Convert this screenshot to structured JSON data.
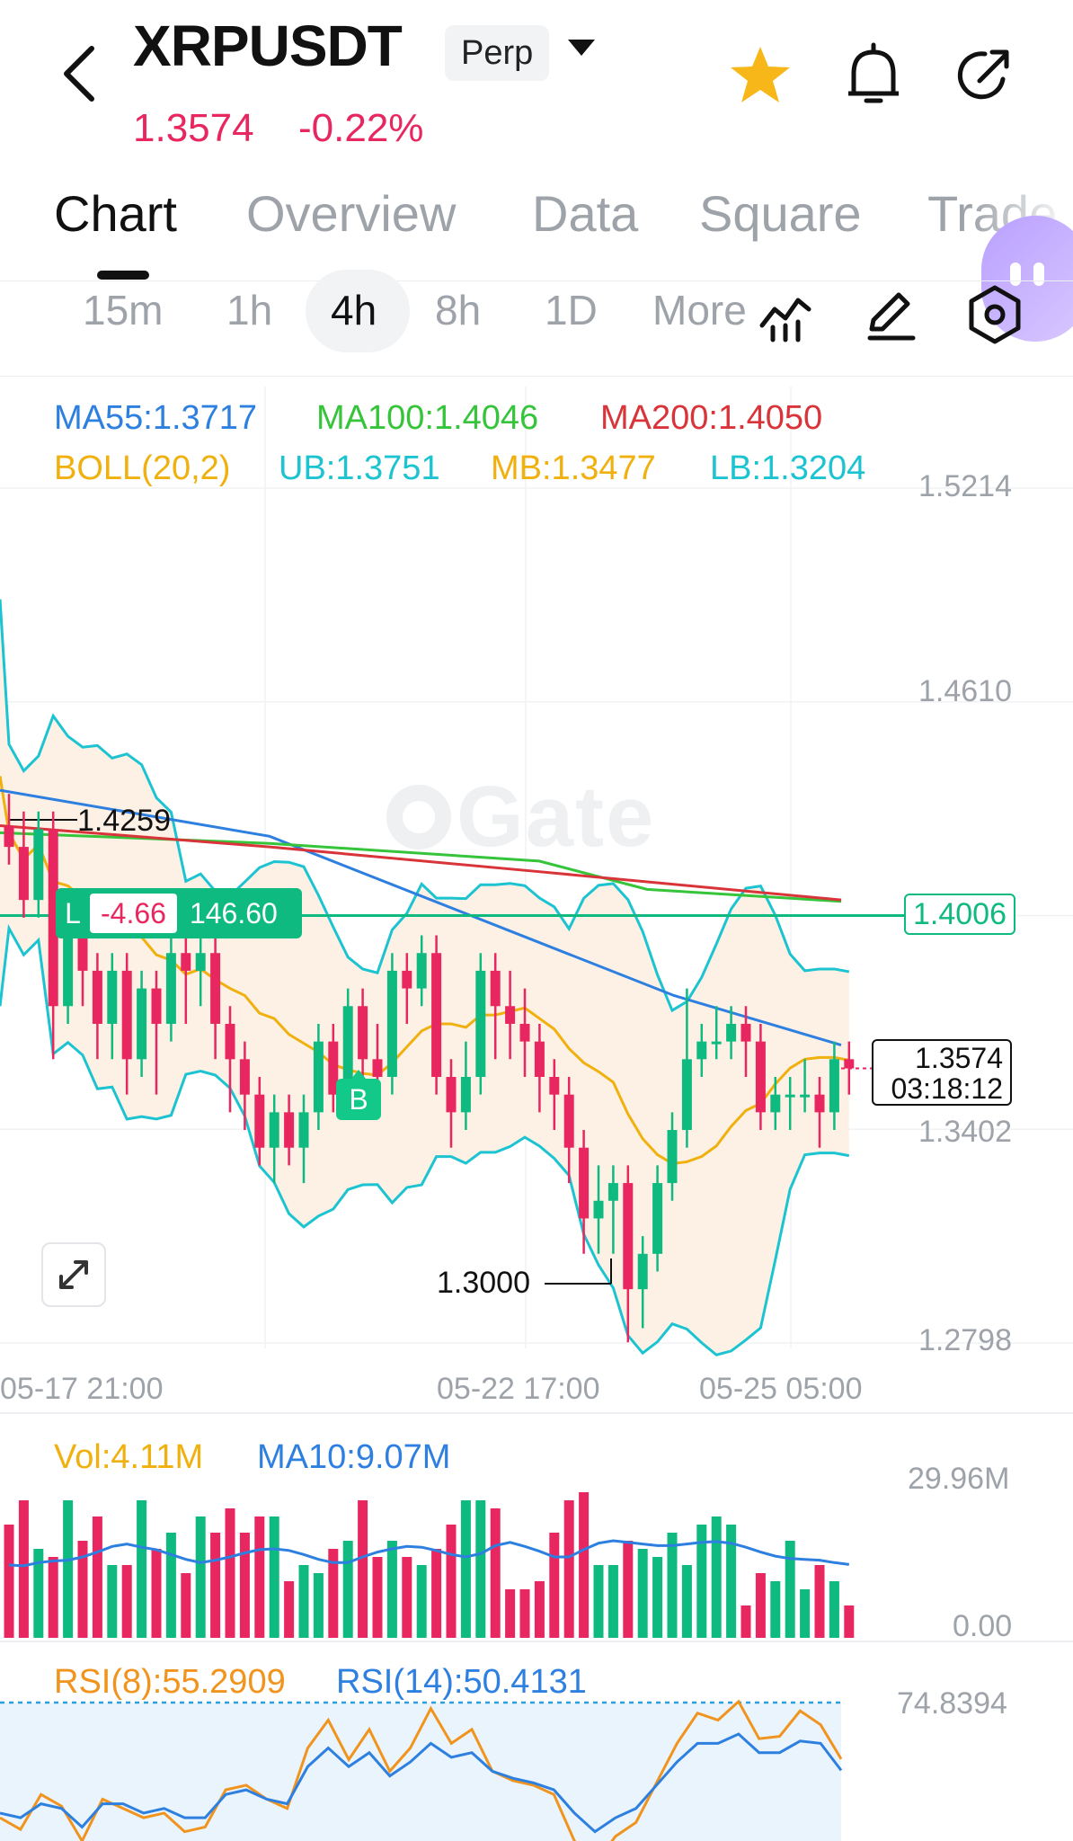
{
  "header": {
    "back_icon": "chevron-left-icon",
    "symbol": "XRPUSDT",
    "contract_type": "Perp",
    "price": "1.3574",
    "change": "-0.22%",
    "icons": [
      "star-icon",
      "bell-icon",
      "share-icon"
    ],
    "colors": {
      "down": "#e8265f",
      "up": "#0fba81",
      "star": "#f7b718"
    }
  },
  "tabs": [
    {
      "label": "Chart",
      "active": true
    },
    {
      "label": "Overview"
    },
    {
      "label": "Data"
    },
    {
      "label": "Square"
    },
    {
      "label": "Trade"
    }
  ],
  "timeframes": [
    {
      "label": "15m"
    },
    {
      "label": "1h"
    },
    {
      "label": "4h",
      "active": true
    },
    {
      "label": "8h"
    },
    {
      "label": "1D"
    },
    {
      "label": "More"
    }
  ],
  "toolbar_icons": [
    "indicator-icon",
    "draw-pen-icon",
    "settings-hex-icon"
  ],
  "indicators": {
    "ma55": "MA55:1.3717",
    "ma100": "MA100:1.4046",
    "ma200": "MA200:1.4050",
    "boll": "BOLL(20,2)",
    "ub": "UB:1.3751",
    "mb": "MB:1.3477",
    "lb": "LB:1.3204"
  },
  "price_axis": [
    "1.5214",
    "1.4610",
    "1.3402",
    "1.2798"
  ],
  "time_axis": [
    "05-17 21:00",
    "05-22 17:00",
    "05-25 05:00"
  ],
  "watermark": "Gate",
  "high_label": "1.4259",
  "low_label": "1.3000",
  "position": {
    "side": "L",
    "pnl": "-4.66",
    "entry": "146.60",
    "line_price": "1.4006"
  },
  "current_tag": {
    "price": "1.3574",
    "countdown": "03:18:12"
  },
  "buy_marker": "B",
  "volume": {
    "vol": "Vol:4.11M",
    "ma10": "MA10:9.07M",
    "max": "29.96M",
    "min": "0.00"
  },
  "rsi": {
    "rsi8": "RSI(8):55.2909",
    "rsi14": "RSI(14):50.4131",
    "top": "74.8394"
  },
  "chart_data": {
    "type": "candlestick",
    "y_range": [
      1.2798,
      1.5214
    ],
    "candles": [
      [
        1.4259,
        1.42,
        1.435,
        1.415
      ],
      [
        1.42,
        1.405,
        1.43,
        1.4
      ],
      [
        1.405,
        1.425,
        1.43,
        1.4
      ],
      [
        1.425,
        1.375,
        1.43,
        1.36
      ],
      [
        1.375,
        1.4,
        1.405,
        1.37
      ],
      [
        1.4,
        1.385,
        1.4,
        1.375
      ],
      [
        1.385,
        1.37,
        1.39,
        1.36
      ],
      [
        1.37,
        1.385,
        1.39,
        1.36
      ],
      [
        1.385,
        1.36,
        1.39,
        1.35
      ],
      [
        1.36,
        1.38,
        1.385,
        1.355
      ],
      [
        1.38,
        1.37,
        1.385,
        1.35
      ],
      [
        1.37,
        1.39,
        1.395,
        1.365
      ],
      [
        1.39,
        1.385,
        1.395,
        1.37
      ],
      [
        1.385,
        1.39,
        1.395,
        1.375
      ],
      [
        1.39,
        1.37,
        1.395,
        1.36
      ],
      [
        1.37,
        1.36,
        1.375,
        1.345
      ],
      [
        1.36,
        1.35,
        1.365,
        1.34
      ],
      [
        1.35,
        1.335,
        1.355,
        1.33
      ],
      [
        1.335,
        1.345,
        1.35,
        1.325
      ],
      [
        1.345,
        1.335,
        1.35,
        1.33
      ],
      [
        1.335,
        1.345,
        1.35,
        1.325
      ],
      [
        1.345,
        1.365,
        1.37,
        1.34
      ],
      [
        1.365,
        1.35,
        1.37,
        1.345
      ],
      [
        1.35,
        1.375,
        1.38,
        1.345
      ],
      [
        1.375,
        1.36,
        1.38,
        1.35
      ],
      [
        1.36,
        1.355,
        1.37,
        1.345
      ],
      [
        1.355,
        1.385,
        1.39,
        1.35
      ],
      [
        1.385,
        1.38,
        1.39,
        1.37
      ],
      [
        1.38,
        1.39,
        1.395,
        1.375
      ],
      [
        1.39,
        1.355,
        1.395,
        1.35
      ],
      [
        1.355,
        1.345,
        1.36,
        1.335
      ],
      [
        1.345,
        1.355,
        1.365,
        1.34
      ],
      [
        1.355,
        1.385,
        1.39,
        1.35
      ],
      [
        1.385,
        1.375,
        1.39,
        1.36
      ],
      [
        1.375,
        1.37,
        1.385,
        1.36
      ],
      [
        1.37,
        1.365,
        1.38,
        1.355
      ],
      [
        1.365,
        1.355,
        1.37,
        1.345
      ],
      [
        1.355,
        1.35,
        1.36,
        1.34
      ],
      [
        1.35,
        1.335,
        1.355,
        1.325
      ],
      [
        1.335,
        1.315,
        1.34,
        1.305
      ],
      [
        1.315,
        1.32,
        1.33,
        1.305
      ],
      [
        1.32,
        1.325,
        1.33,
        1.305
      ],
      [
        1.325,
        1.295,
        1.33,
        1.28
      ],
      [
        1.295,
        1.305,
        1.31,
        1.284
      ],
      [
        1.305,
        1.325,
        1.33,
        1.3
      ],
      [
        1.325,
        1.34,
        1.345,
        1.32
      ],
      [
        1.34,
        1.36,
        1.38,
        1.335
      ],
      [
        1.36,
        1.365,
        1.37,
        1.355
      ],
      [
        1.365,
        1.365,
        1.375,
        1.36
      ],
      [
        1.365,
        1.37,
        1.375,
        1.36
      ],
      [
        1.37,
        1.365,
        1.375,
        1.355
      ],
      [
        1.365,
        1.345,
        1.37,
        1.34
      ],
      [
        1.345,
        1.35,
        1.355,
        1.34
      ],
      [
        1.35,
        1.35,
        1.355,
        1.34
      ],
      [
        1.35,
        1.35,
        1.36,
        1.345
      ],
      [
        1.35,
        1.345,
        1.355,
        1.335
      ],
      [
        1.345,
        1.36,
        1.365,
        1.34
      ],
      [
        1.36,
        1.3574,
        1.365,
        1.35
      ]
    ],
    "volume": [
      14,
      17,
      11,
      10,
      17,
      12,
      15,
      9,
      9,
      17,
      11,
      13,
      8,
      15,
      13,
      16,
      13,
      15,
      15,
      7,
      9,
      8,
      11,
      12,
      17,
      10,
      12,
      10,
      9,
      11,
      14,
      17,
      17,
      16,
      6,
      6,
      7,
      13,
      17,
      18,
      9,
      9,
      12,
      11,
      10,
      13,
      9,
      14,
      15,
      14,
      4,
      8,
      7,
      12,
      6,
      9,
      7,
      4
    ],
    "ma10": [
      9,
      8.9,
      9.3,
      9.5,
      9.6,
      10,
      10.6,
      11.3,
      11.6,
      11.2,
      10.9,
      10.3,
      9.7,
      9.3,
      9.6,
      10,
      10.5,
      10.9,
      11,
      10.8,
      10.3,
      9.7,
      9.3,
      9.3,
      10,
      10.6,
      11,
      11.3,
      11.2,
      10.8,
      10.3,
      10,
      10.4,
      11.4,
      11.8,
      11.3,
      10.7,
      10,
      10,
      10.9,
      11.7,
      12,
      11.8,
      11.6,
      11.4,
      11.4,
      11.6,
      11.8,
      11.9,
      11.7,
      11.2,
      10.6,
      10.1,
      9.8,
      9.7,
      9.6,
      9.3,
      9.07
    ],
    "rsi8": [
      30,
      25,
      40,
      35,
      20,
      38,
      34,
      30,
      32,
      24,
      26,
      42,
      44,
      38,
      34,
      60,
      72,
      55,
      68,
      50,
      60,
      77,
      62,
      68,
      50,
      46,
      44,
      40,
      20,
      10,
      22,
      28,
      45,
      62,
      75,
      72,
      80,
      64,
      65,
      76,
      70,
      55.29
    ],
    "rsi14": [
      32,
      30,
      36,
      34,
      26,
      36,
      36,
      32,
      34,
      30,
      30,
      40,
      42,
      38,
      36,
      52,
      60,
      52,
      58,
      48,
      54,
      62,
      56,
      58,
      50,
      47,
      45,
      42,
      32,
      24,
      30,
      34,
      44,
      54,
      62,
      62,
      66,
      58,
      58,
      63,
      62,
      50.41
    ]
  }
}
